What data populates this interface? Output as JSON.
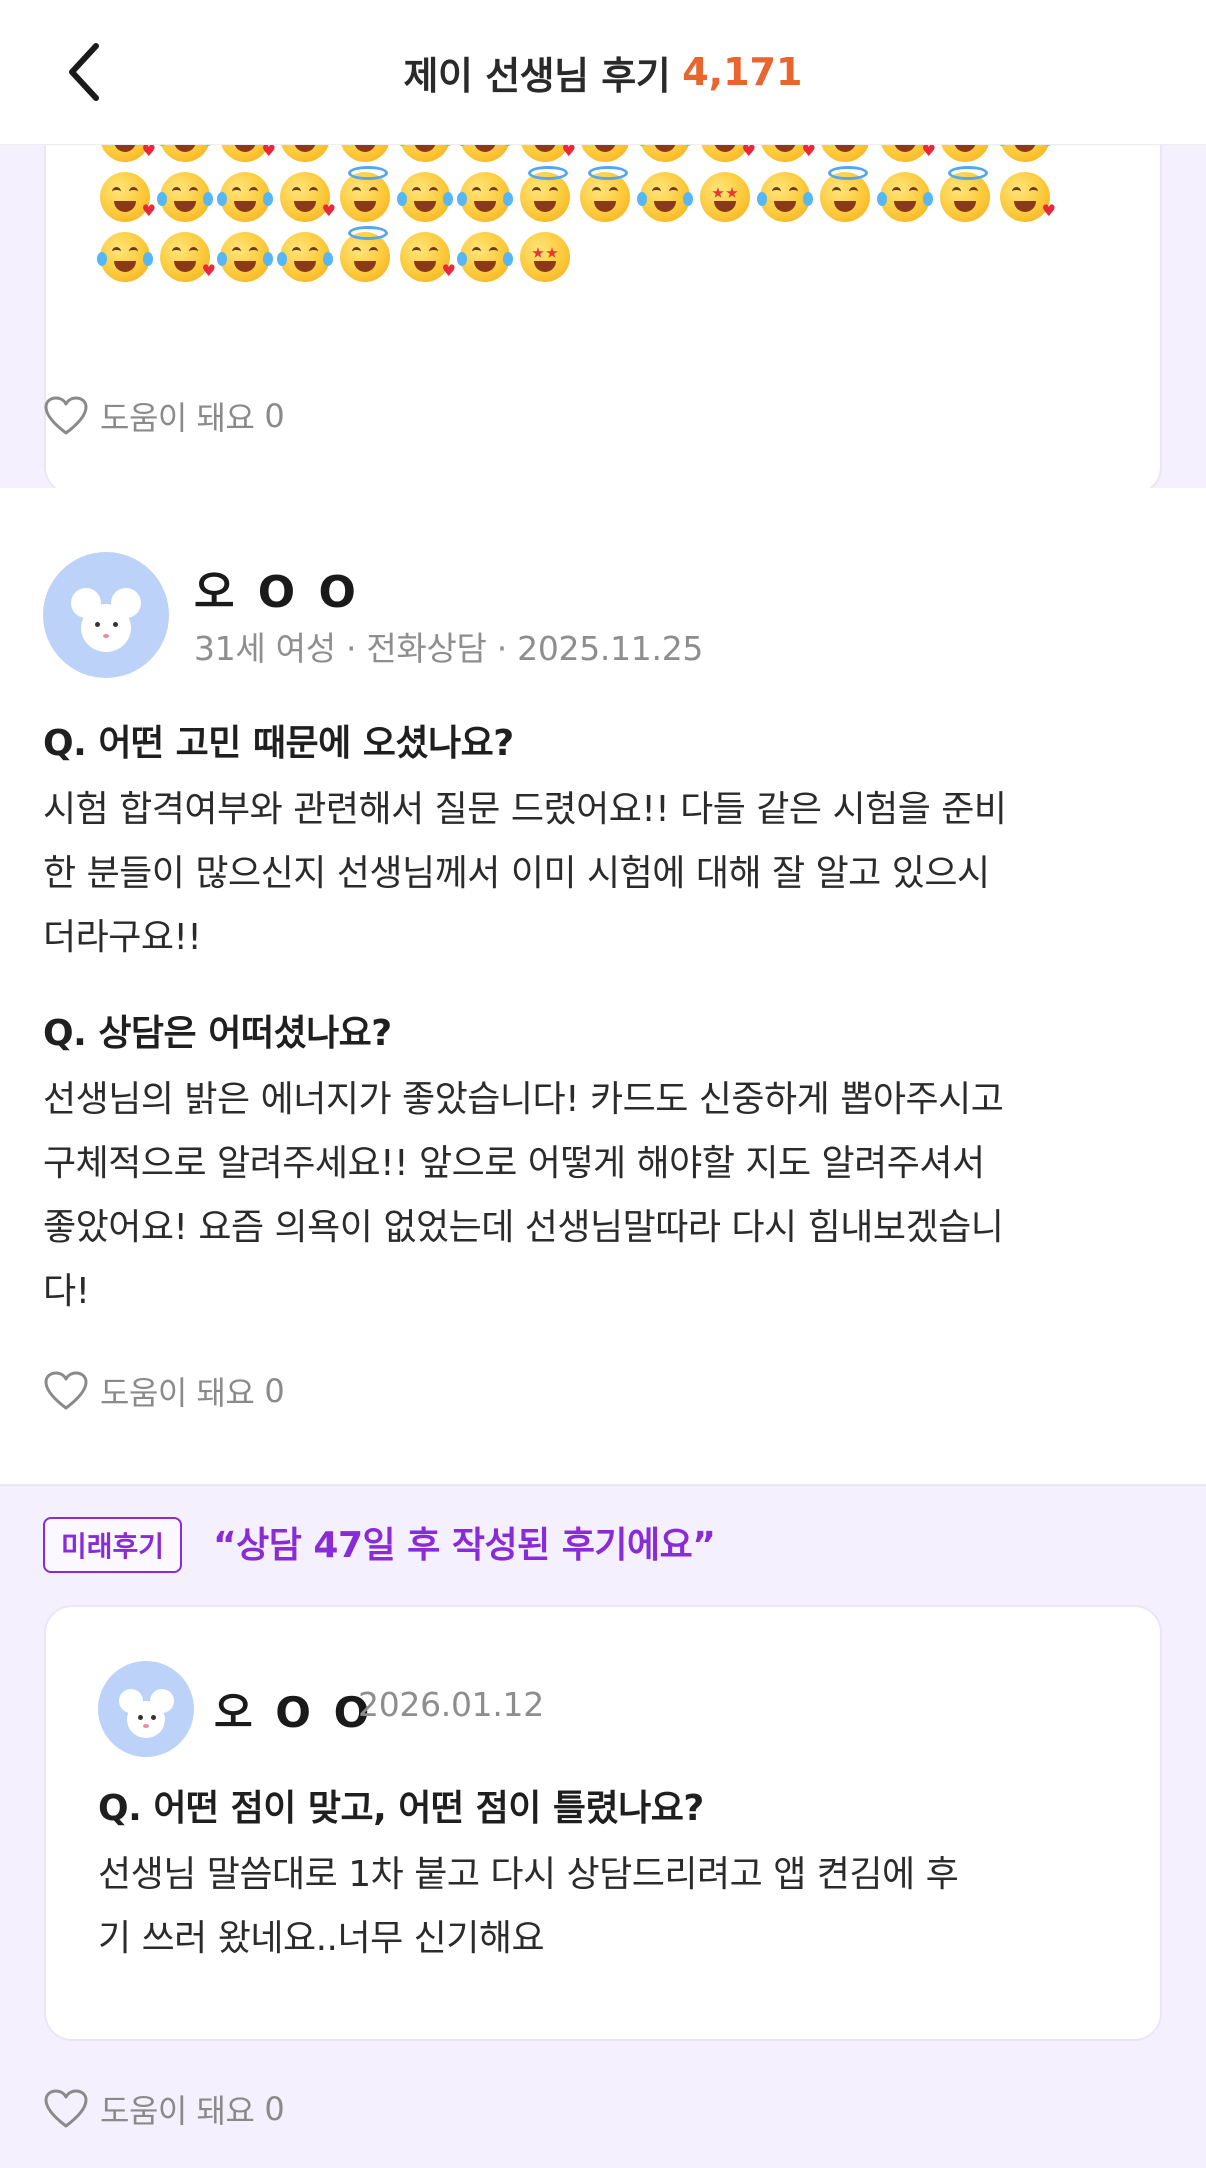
{
  "header": {
    "title": "제이 선생님 후기",
    "count": "4,171"
  },
  "reviews": [
    {
      "helpful_label": "도움이 돼요",
      "helpful_count": "0"
    },
    {
      "name": "오 O O",
      "meta": "31세 여성 · 전화상담 · 2025.11.25",
      "q1": "Q. 어떤 고민 때문에 오셨나요?",
      "a1": "시험 합격여부와 관련해서 질문 드렸어요!! 다들 같은 시험을 준비\n한 분들이 많으신지 선생님께서 이미 시험에 대해 잘 알고 있으시\n더라구요!!",
      "q2": "Q. 상담은 어떠셨나요?",
      "a2": "선생님의 밝은 에너지가 좋았습니다! 카드도 신중하게 뽑아주시고\n구체적으로 알려주세요!! 앞으로 어떻게 해야할 지도 알려주셔서\n좋았어요! 요즘 의욕이 없었는데 선생님말따라 다시 힘내보겠습니\n다!",
      "helpful_label": "도움이 돼요",
      "helpful_count": "0"
    },
    {
      "badge": "미래후기",
      "quote": "“상담 47일 후 작성된 후기에요”",
      "name": "오 O O",
      "date": "2026.01.12",
      "q1": "Q. 어떤 점이 맞고, 어떤 점이 틀렸나요?",
      "a1": "선생님 말씀대로 1차 붙고 다시 상담드리려고 앱 켠김에 후\n기 쓰러 왔네요..너무 신기해요",
      "helpful_label": "도움이 돼요",
      "helpful_count": "0"
    }
  ],
  "emoji_rows": [
    [
      "love",
      "joy",
      "love",
      "halo",
      "halo",
      "joy",
      "joy",
      "love",
      "halo",
      "joy",
      "love",
      "love",
      "halo",
      "love",
      "halo",
      "joy"
    ],
    [
      "love",
      "joy",
      "joy",
      "love",
      "halo",
      "joy",
      "joy",
      "halo",
      "halo",
      "joy",
      "star",
      "joy",
      "halo",
      "joy",
      "halo",
      "love"
    ],
    [
      "joy",
      "love",
      "joy",
      "joy",
      "halo",
      "love",
      "joy",
      "star"
    ]
  ],
  "colors": {
    "accent_orange": "#e8652f",
    "purple": "#8a2bd8",
    "section_bg": "#f5f0fd"
  }
}
